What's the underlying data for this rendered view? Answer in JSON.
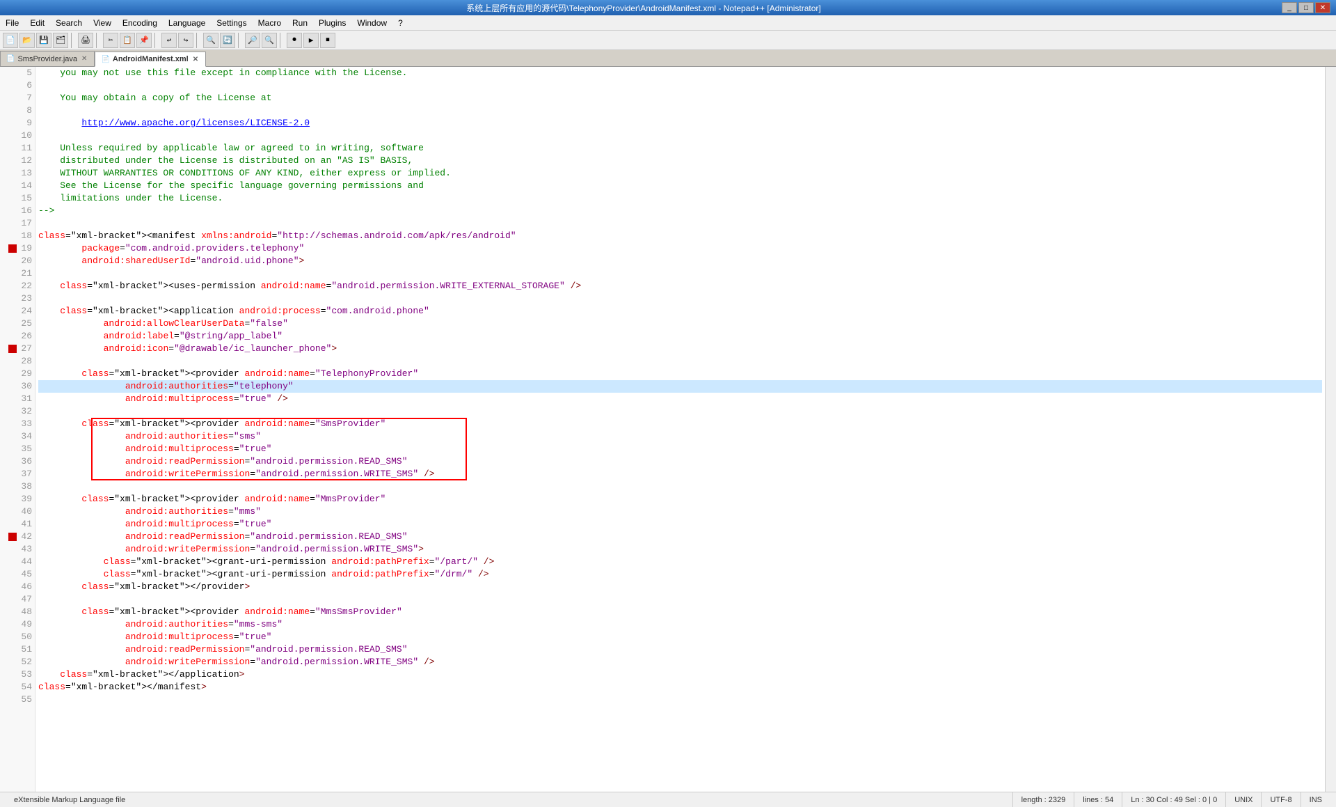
{
  "titleBar": {
    "text": "系统上层所有应用的源代码\\TelephonyProvider\\AndroidManifest.xml - Notepad++ [Administrator]",
    "controls": [
      "_",
      "□",
      "✕"
    ]
  },
  "menuBar": {
    "items": [
      "File",
      "Edit",
      "Search",
      "View",
      "Encoding",
      "Language",
      "Settings",
      "Macro",
      "Run",
      "Plugins",
      "Window",
      "?"
    ]
  },
  "tabs": [
    {
      "label": "SmsProvider.java",
      "active": false
    },
    {
      "label": "AndroidManifest.xml",
      "active": true
    }
  ],
  "statusBar": {
    "fileType": "eXtensible Markup Language file",
    "length": "length : 2329",
    "lines": "lines : 54",
    "position": "Ln : 30   Col : 49   Sel : 0 | 0",
    "lineEnding": "UNIX",
    "encoding": "UTF-8",
    "mode": "INS"
  },
  "code": {
    "lines": [
      {
        "num": 5,
        "content": "    you may not use this file except in compliance with the License."
      },
      {
        "num": 6,
        "content": ""
      },
      {
        "num": 7,
        "content": "    You may obtain a copy of the License at"
      },
      {
        "num": 8,
        "content": ""
      },
      {
        "num": 9,
        "content": "        http://www.apache.org/licenses/LICENSE-2.0"
      },
      {
        "num": 10,
        "content": ""
      },
      {
        "num": 11,
        "content": "    Unless required by applicable law or agreed to in writing, software"
      },
      {
        "num": 12,
        "content": "    distributed under the License is distributed on an \"AS IS\" BASIS,"
      },
      {
        "num": 13,
        "content": "    WITHOUT WARRANTIES OR CONDITIONS OF ANY KIND, either express or implied."
      },
      {
        "num": 14,
        "content": "    See the License for the specific language governing permissions and"
      },
      {
        "num": 15,
        "content": "    limitations under the License."
      },
      {
        "num": 16,
        "content": "-->"
      },
      {
        "num": 17,
        "content": ""
      },
      {
        "num": 18,
        "content": "<manifest xmlns:android=\"http://schemas.android.com/apk/res/android\""
      },
      {
        "num": 19,
        "content": "        package=\"com.android.providers.telephony\""
      },
      {
        "num": 20,
        "content": "        android:sharedUserId=\"android.uid.phone\">"
      },
      {
        "num": 21,
        "content": ""
      },
      {
        "num": 22,
        "content": "    <uses-permission android:name=\"android.permission.WRITE_EXTERNAL_STORAGE\" />"
      },
      {
        "num": 23,
        "content": ""
      },
      {
        "num": 24,
        "content": "    <application android:process=\"com.android.phone\""
      },
      {
        "num": 25,
        "content": "            android:allowClearUserData=\"false\""
      },
      {
        "num": 26,
        "content": "            android:label=\"@string/app_label\""
      },
      {
        "num": 27,
        "content": "            android:icon=\"@drawable/ic_launcher_phone\">"
      },
      {
        "num": 28,
        "content": ""
      },
      {
        "num": 29,
        "content": "        <provider android:name=\"TelephonyProvider\""
      },
      {
        "num": 30,
        "content": "                android:authorities=\"telephony\""
      },
      {
        "num": 31,
        "content": "                android:multiprocess=\"true\" />"
      },
      {
        "num": 32,
        "content": ""
      },
      {
        "num": 33,
        "content": "        <provider android:name=\"SmsProvider\""
      },
      {
        "num": 34,
        "content": "                android:authorities=\"sms\""
      },
      {
        "num": 35,
        "content": "                android:multiprocess=\"true\""
      },
      {
        "num": 36,
        "content": "                android:readPermission=\"android.permission.READ_SMS\""
      },
      {
        "num": 37,
        "content": "                android:writePermission=\"android.permission.WRITE_SMS\" />"
      },
      {
        "num": 38,
        "content": ""
      },
      {
        "num": 39,
        "content": "        <provider android:name=\"MmsProvider\""
      },
      {
        "num": 40,
        "content": "                android:authorities=\"mms\""
      },
      {
        "num": 41,
        "content": "                android:multiprocess=\"true\""
      },
      {
        "num": 42,
        "content": "                android:readPermission=\"android.permission.READ_SMS\""
      },
      {
        "num": 43,
        "content": "                android:writePermission=\"android.permission.WRITE_SMS\">"
      },
      {
        "num": 44,
        "content": "            <grant-uri-permission android:pathPrefix=\"/part/\" />"
      },
      {
        "num": 45,
        "content": "            <grant-uri-permission android:pathPrefix=\"/drm/\" />"
      },
      {
        "num": 46,
        "content": "        </provider>"
      },
      {
        "num": 47,
        "content": ""
      },
      {
        "num": 48,
        "content": "        <provider android:name=\"MmsSmsProvider\""
      },
      {
        "num": 49,
        "content": "                android:authorities=\"mms-sms\""
      },
      {
        "num": 50,
        "content": "                android:multiprocess=\"true\""
      },
      {
        "num": 51,
        "content": "                android:readPermission=\"android.permission.READ_SMS\""
      },
      {
        "num": 52,
        "content": "                android:writePermission=\"android.permission.WRITE_SMS\" />"
      },
      {
        "num": 53,
        "content": "    </application>"
      },
      {
        "num": 54,
        "content": "</manifest>"
      },
      {
        "num": 55,
        "content": ""
      }
    ]
  }
}
